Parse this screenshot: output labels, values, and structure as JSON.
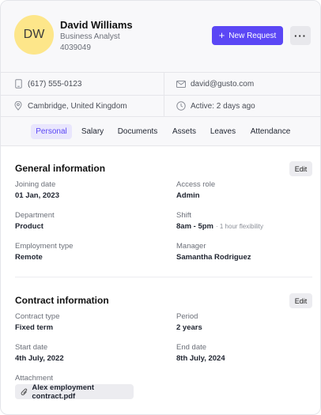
{
  "profile": {
    "initials": "DW",
    "name": "David Williams",
    "title": "Business Analyst",
    "employee_id": "4039049",
    "avatar_color": "#fde68a"
  },
  "actions": {
    "new_request": "New Request",
    "more": "···",
    "primary_color": "#5b47f5"
  },
  "contact": {
    "phone": "(617) 555-0123",
    "email": "david@gusto.com",
    "location": "Cambridge, United Kingdom",
    "activity": "Active: 2 days ago"
  },
  "tabs": [
    {
      "label": "Personal",
      "active": true
    },
    {
      "label": "Salary",
      "active": false
    },
    {
      "label": "Documents",
      "active": false
    },
    {
      "label": "Assets",
      "active": false
    },
    {
      "label": "Leaves",
      "active": false
    },
    {
      "label": "Attendance",
      "active": false
    }
  ],
  "general": {
    "title": "General information",
    "edit": "Edit",
    "joining_date_label": "Joining date",
    "joining_date": "01 Jan, 2023",
    "access_role_label": "Access role",
    "access_role": "Admin",
    "department_label": "Department",
    "department": "Product",
    "shift_label": "Shift",
    "shift": "8am - 5pm",
    "shift_note": "· 1 hour flexibility",
    "employment_type_label": "Employment type",
    "employment_type": "Remote",
    "manager_label": "Manager",
    "manager": "Samantha Rodriguez"
  },
  "contract": {
    "title": "Contract information",
    "edit": "Edit",
    "type_label": "Contract type",
    "type": "Fixed term",
    "period_label": "Period",
    "period": "2 years",
    "start_label": "Start date",
    "start": "4th July, 2022",
    "end_label": "End date",
    "end": "8th July, 2024",
    "attachment_label": "Attachment",
    "attachment_file": "Alex employment contract.pdf"
  }
}
